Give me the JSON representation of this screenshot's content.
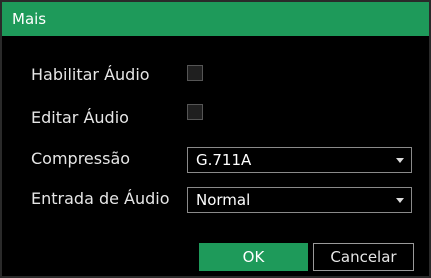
{
  "dialog": {
    "title": "Mais"
  },
  "form": {
    "habilitar_audio": {
      "label": "Habilitar Áudio",
      "checked": false
    },
    "editar_audio": {
      "label": "Editar Áudio",
      "checked": false
    },
    "compressao": {
      "label": "Compressão",
      "value": "G.711A"
    },
    "entrada_audio": {
      "label": "Entrada de Áudio",
      "value": "Normal"
    }
  },
  "buttons": {
    "ok": "OK",
    "cancel": "Cancelar"
  },
  "colors": {
    "accent": "#1e9a5a",
    "background": "#000000"
  }
}
